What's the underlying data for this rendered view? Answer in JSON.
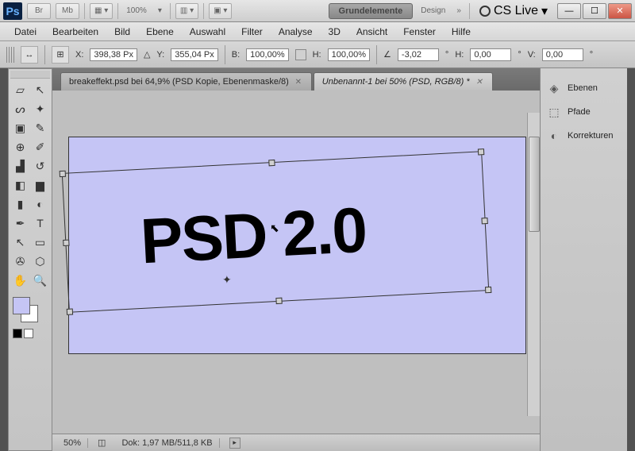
{
  "titlebar": {
    "logo": "Ps",
    "btn_br": "Br",
    "btn_mb": "Mb",
    "zoom_label": "100%",
    "grundelemente": "Grundelemente",
    "design": "Design",
    "chevrons": "»",
    "cslive": "CS Live"
  },
  "menu": {
    "items": [
      "Datei",
      "Bearbeiten",
      "Bild",
      "Ebene",
      "Auswahl",
      "Filter",
      "Analyse",
      "3D",
      "Ansicht",
      "Fenster",
      "Hilfe"
    ]
  },
  "options": {
    "x_label": "X:",
    "x_value": "398,38 Px",
    "y_label": "Y:",
    "y_value": "355,04 Px",
    "w_label": "B:",
    "w_value": "100,00%",
    "h_label": "H:",
    "h_value": "100,00%",
    "angle_value": "-3,02",
    "hskew_label": "H:",
    "hskew_value": "0,00",
    "vskew_label": "V:",
    "vskew_value": "0,00",
    "deg": "°"
  },
  "tabs": {
    "0": {
      "label": "breakeffekt.psd bei 64,9% (PSD Kopie, Ebenenmaske/8)"
    },
    "1": {
      "label": "Unbenannt-1 bei 50% (PSD, RGB/8) *"
    }
  },
  "canvas": {
    "text": "PSD 2.0"
  },
  "status": {
    "zoom": "50%",
    "doc": "Dok: 1,97 MB/511,8 KB"
  },
  "panels": {
    "ebenen": "Ebenen",
    "pfade": "Pfade",
    "korrekturen": "Korrekturen"
  }
}
